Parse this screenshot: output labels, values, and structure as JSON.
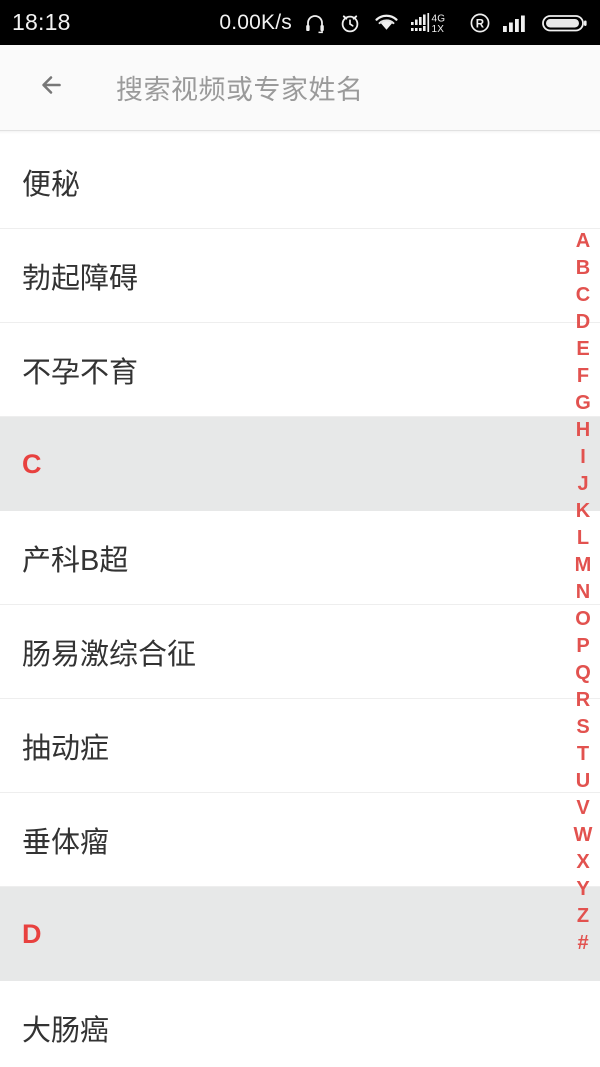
{
  "status_bar": {
    "time": "18:18",
    "network_speed": "0.00K/s",
    "signal_label_top": "4G",
    "signal_label_bottom": "1X",
    "roaming_label": "R",
    "icons": [
      "headphone-icon",
      "alarm-clock-icon",
      "wifi-icon",
      "dual-sim-signal-icon",
      "roaming-icon",
      "signal-bars-icon",
      "battery-icon"
    ]
  },
  "header": {
    "back_icon": "back-arrow-icon",
    "search_placeholder": "搜索视频或专家姓名",
    "search_value": ""
  },
  "colors": {
    "accent_red": "#e8413f",
    "index_red": "#e2524f",
    "section_bg": "#e7e8e8",
    "row_text": "#333333",
    "placeholder": "#9a9a9a"
  },
  "list": [
    {
      "type": "row",
      "label": "便秘"
    },
    {
      "type": "row",
      "label": "勃起障碍"
    },
    {
      "type": "row",
      "label": "不孕不育"
    },
    {
      "type": "section",
      "label": "C"
    },
    {
      "type": "row",
      "label": "产科B超"
    },
    {
      "type": "row",
      "label": "肠易激综合征"
    },
    {
      "type": "row",
      "label": "抽动症"
    },
    {
      "type": "row",
      "label": "垂体瘤"
    },
    {
      "type": "section",
      "label": "D"
    },
    {
      "type": "row",
      "label": "大肠癌"
    }
  ],
  "index_bar": {
    "letters": [
      "A",
      "B",
      "C",
      "D",
      "E",
      "F",
      "G",
      "H",
      "I",
      "J",
      "K",
      "L",
      "M",
      "N",
      "O",
      "P",
      "Q",
      "R",
      "S",
      "T",
      "U",
      "V",
      "W",
      "X",
      "Y",
      "Z",
      "#"
    ]
  }
}
